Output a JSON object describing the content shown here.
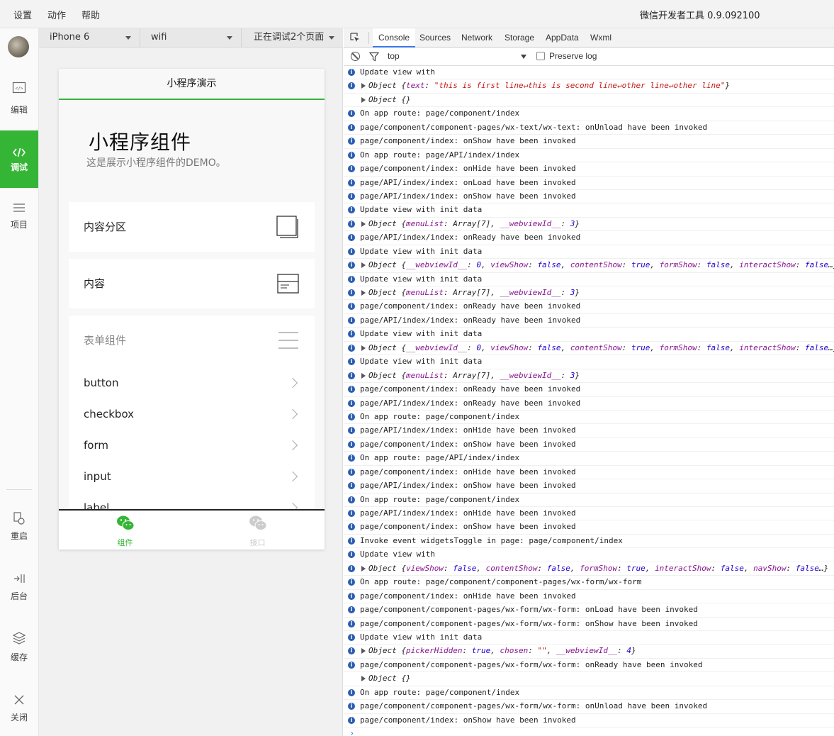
{
  "menubar": {
    "items": [
      "设置",
      "动作",
      "帮助"
    ],
    "title": "微信开发者工具 0.9.092100"
  },
  "sidebar": {
    "items": [
      {
        "label": "编辑",
        "icon": "code-window-icon"
      },
      {
        "label": "调试",
        "icon": "code-brackets-icon",
        "active": true
      },
      {
        "label": "项目",
        "icon": "list-icon"
      },
      {
        "label": "重启",
        "icon": "restart-icon"
      },
      {
        "label": "后台",
        "icon": "background-icon"
      },
      {
        "label": "缓存",
        "icon": "layers-icon"
      },
      {
        "label": "关闭",
        "icon": "close-icon"
      }
    ]
  },
  "simulator": {
    "device": "iPhone 6",
    "network": "wifi",
    "debug_pages": "正在调试2个页面",
    "nav_title": "小程序演示",
    "header_title": "小程序组件",
    "header_desc": "这是展示小程序组件的DEMO。",
    "cards": [
      {
        "label": "内容分区",
        "icon": "view-icon"
      },
      {
        "label": "内容",
        "icon": "content-icon"
      }
    ],
    "form_section": {
      "label": "表单组件",
      "icon": "form-icon",
      "items": [
        "button",
        "checkbox",
        "form",
        "input",
        "label"
      ]
    },
    "tabs": [
      {
        "label": "组件",
        "active": true,
        "color": "#35b535"
      },
      {
        "label": "接口",
        "active": false,
        "color": "#cccccc"
      }
    ]
  },
  "devtools": {
    "tabs": [
      "Console",
      "Sources",
      "Network",
      "Storage",
      "AppData",
      "Wxml"
    ],
    "active_tab": "Console",
    "context": "top",
    "preserve_log": "Preserve log",
    "logs": [
      {
        "type": "info",
        "text": "Update view with"
      },
      {
        "type": "info-obj",
        "obj": [
          [
            "p",
            "Object {"
          ],
          [
            "k",
            "text"
          ],
          [
            "p",
            ": "
          ],
          [
            "s",
            "\"this is first line↵this is second line↵other line↵other line\""
          ],
          [
            "p",
            "}"
          ]
        ]
      },
      {
        "type": "obj",
        "obj": [
          [
            "p",
            "Object {}"
          ]
        ]
      },
      {
        "type": "info",
        "text": "On app route: page/component/index"
      },
      {
        "type": "info",
        "text": "page/component/component-pages/wx-text/wx-text: onUnload have been invoked"
      },
      {
        "type": "info",
        "text": "page/component/index: onShow have been invoked"
      },
      {
        "type": "info",
        "text": "On app route: page/API/index/index"
      },
      {
        "type": "info",
        "text": "page/component/index: onHide have been invoked"
      },
      {
        "type": "info",
        "text": "page/API/index/index: onLoad have been invoked"
      },
      {
        "type": "info",
        "text": "page/API/index/index: onShow have been invoked"
      },
      {
        "type": "info",
        "text": "Update view with init data"
      },
      {
        "type": "info-obj",
        "obj": [
          [
            "p",
            "Object {"
          ],
          [
            "k",
            "menuList"
          ],
          [
            "p",
            ": Array[7], "
          ],
          [
            "k",
            "__webviewId__"
          ],
          [
            "p",
            ": "
          ],
          [
            "n",
            "3"
          ],
          [
            "p",
            "}"
          ]
        ]
      },
      {
        "type": "info",
        "text": "page/API/index/index: onReady have been invoked"
      },
      {
        "type": "info",
        "text": "Update view with init data"
      },
      {
        "type": "info-obj",
        "obj": [
          [
            "p",
            "Object {"
          ],
          [
            "k",
            "__webviewId__"
          ],
          [
            "p",
            ": "
          ],
          [
            "n",
            "0"
          ],
          [
            "p",
            ", "
          ],
          [
            "k",
            "viewShow"
          ],
          [
            "p",
            ": "
          ],
          [
            "n",
            "false"
          ],
          [
            "p",
            ", "
          ],
          [
            "k",
            "contentShow"
          ],
          [
            "p",
            ": "
          ],
          [
            "n",
            "true"
          ],
          [
            "p",
            ", "
          ],
          [
            "k",
            "formShow"
          ],
          [
            "p",
            ": "
          ],
          [
            "n",
            "false"
          ],
          [
            "p",
            ", "
          ],
          [
            "k",
            "interactShow"
          ],
          [
            "p",
            ": "
          ],
          [
            "n",
            "false"
          ],
          [
            "p",
            "…}"
          ]
        ]
      },
      {
        "type": "info",
        "text": "Update view with init data"
      },
      {
        "type": "info-obj",
        "obj": [
          [
            "p",
            "Object {"
          ],
          [
            "k",
            "menuList"
          ],
          [
            "p",
            ": Array[7], "
          ],
          [
            "k",
            "__webviewId__"
          ],
          [
            "p",
            ": "
          ],
          [
            "n",
            "3"
          ],
          [
            "p",
            "}"
          ]
        ]
      },
      {
        "type": "info",
        "text": "page/component/index: onReady have been invoked"
      },
      {
        "type": "info",
        "text": "page/API/index/index: onReady have been invoked"
      },
      {
        "type": "info",
        "text": "Update view with init data"
      },
      {
        "type": "info-obj",
        "obj": [
          [
            "p",
            "Object {"
          ],
          [
            "k",
            "__webviewId__"
          ],
          [
            "p",
            ": "
          ],
          [
            "n",
            "0"
          ],
          [
            "p",
            ", "
          ],
          [
            "k",
            "viewShow"
          ],
          [
            "p",
            ": "
          ],
          [
            "n",
            "false"
          ],
          [
            "p",
            ", "
          ],
          [
            "k",
            "contentShow"
          ],
          [
            "p",
            ": "
          ],
          [
            "n",
            "true"
          ],
          [
            "p",
            ", "
          ],
          [
            "k",
            "formShow"
          ],
          [
            "p",
            ": "
          ],
          [
            "n",
            "false"
          ],
          [
            "p",
            ", "
          ],
          [
            "k",
            "interactShow"
          ],
          [
            "p",
            ": "
          ],
          [
            "n",
            "false"
          ],
          [
            "p",
            "…}"
          ]
        ]
      },
      {
        "type": "info",
        "text": "Update view with init data"
      },
      {
        "type": "info-obj",
        "obj": [
          [
            "p",
            "Object {"
          ],
          [
            "k",
            "menuList"
          ],
          [
            "p",
            ": Array[7], "
          ],
          [
            "k",
            "__webviewId__"
          ],
          [
            "p",
            ": "
          ],
          [
            "n",
            "3"
          ],
          [
            "p",
            "}"
          ]
        ]
      },
      {
        "type": "info",
        "text": "page/component/index: onReady have been invoked"
      },
      {
        "type": "info",
        "text": "page/API/index/index: onReady have been invoked"
      },
      {
        "type": "info",
        "text": "On app route: page/component/index"
      },
      {
        "type": "info",
        "text": "page/API/index/index: onHide have been invoked"
      },
      {
        "type": "info",
        "text": "page/component/index: onShow have been invoked"
      },
      {
        "type": "info",
        "text": "On app route: page/API/index/index"
      },
      {
        "type": "info",
        "text": "page/component/index: onHide have been invoked"
      },
      {
        "type": "info",
        "text": "page/API/index/index: onShow have been invoked"
      },
      {
        "type": "info",
        "text": "On app route: page/component/index"
      },
      {
        "type": "info",
        "text": "page/API/index/index: onHide have been invoked"
      },
      {
        "type": "info",
        "text": "page/component/index: onShow have been invoked"
      },
      {
        "type": "info",
        "text": "Invoke event widgetsToggle in page: page/component/index"
      },
      {
        "type": "info",
        "text": "Update view with"
      },
      {
        "type": "info-obj",
        "obj": [
          [
            "p",
            "Object {"
          ],
          [
            "k",
            "viewShow"
          ],
          [
            "p",
            ": "
          ],
          [
            "n",
            "false"
          ],
          [
            "p",
            ", "
          ],
          [
            "k",
            "contentShow"
          ],
          [
            "p",
            ": "
          ],
          [
            "n",
            "false"
          ],
          [
            "p",
            ", "
          ],
          [
            "k",
            "formShow"
          ],
          [
            "p",
            ": "
          ],
          [
            "n",
            "true"
          ],
          [
            "p",
            ", "
          ],
          [
            "k",
            "interactShow"
          ],
          [
            "p",
            ": "
          ],
          [
            "n",
            "false"
          ],
          [
            "p",
            ", "
          ],
          [
            "k",
            "navShow"
          ],
          [
            "p",
            ": "
          ],
          [
            "n",
            "false"
          ],
          [
            "p",
            "…}"
          ]
        ]
      },
      {
        "type": "info",
        "text": "On app route: page/component/component-pages/wx-form/wx-form"
      },
      {
        "type": "info",
        "text": "page/component/index: onHide have been invoked"
      },
      {
        "type": "info",
        "text": "page/component/component-pages/wx-form/wx-form: onLoad have been invoked"
      },
      {
        "type": "info",
        "text": "page/component/component-pages/wx-form/wx-form: onShow have been invoked"
      },
      {
        "type": "info",
        "text": "Update view with init data"
      },
      {
        "type": "info-obj",
        "obj": [
          [
            "p",
            "Object {"
          ],
          [
            "k",
            "pickerHidden"
          ],
          [
            "p",
            ": "
          ],
          [
            "n",
            "true"
          ],
          [
            "p",
            ", "
          ],
          [
            "k",
            "chosen"
          ],
          [
            "p",
            ": "
          ],
          [
            "s",
            "\"\""
          ],
          [
            "p",
            ", "
          ],
          [
            "k",
            "__webviewId__"
          ],
          [
            "p",
            ": "
          ],
          [
            "n",
            "4"
          ],
          [
            "p",
            "}"
          ]
        ]
      },
      {
        "type": "info",
        "text": "page/component/component-pages/wx-form/wx-form: onReady have been invoked"
      },
      {
        "type": "obj",
        "obj": [
          [
            "p",
            "Object {}"
          ]
        ]
      },
      {
        "type": "info",
        "text": "On app route: page/component/index"
      },
      {
        "type": "info",
        "text": "page/component/component-pages/wx-form/wx-form: onUnload have been invoked"
      },
      {
        "type": "info",
        "text": "page/component/index: onShow have been invoked"
      }
    ],
    "prompt": "›"
  }
}
